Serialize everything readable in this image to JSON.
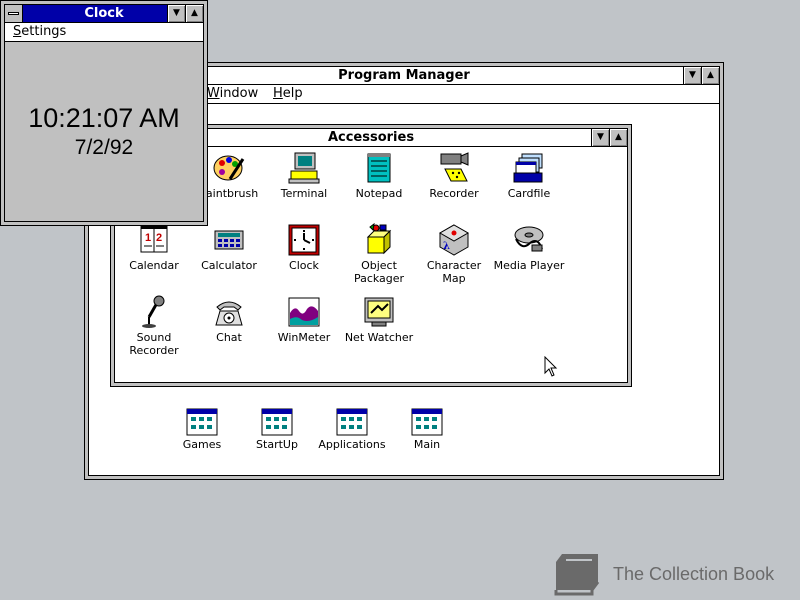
{
  "clock_window": {
    "title": "Clock",
    "menu": {
      "settings_underline": "S",
      "settings_rest": "ettings"
    },
    "time": "10:21:07 AM",
    "date": "7/2/92"
  },
  "program_manager": {
    "title": "Program Manager",
    "menu": {
      "window_label": "indow",
      "help_underline": "H",
      "help_rest": "elp"
    },
    "group_icons": [
      {
        "label": "Games",
        "icon": "program-group-icon"
      },
      {
        "label": "StartUp",
        "icon": "program-group-icon"
      },
      {
        "label": "Applications",
        "icon": "program-group-icon"
      },
      {
        "label": "Main",
        "icon": "program-group-icon"
      }
    ]
  },
  "accessories": {
    "title": "Accessories",
    "icons": [
      {
        "label": "Paintbrush",
        "visible_label": "Paintbrush",
        "icon": "paintbrush-icon"
      },
      {
        "label": "Terminal",
        "icon": "terminal-icon"
      },
      {
        "label": "Notepad",
        "icon": "notepad-icon"
      },
      {
        "label": "Recorder",
        "icon": "recorder-icon"
      },
      {
        "label": "Cardfile",
        "icon": "cardfile-icon"
      },
      {
        "label": "Calendar",
        "icon": "calendar-icon"
      },
      {
        "label": "Calculator",
        "icon": "calculator-icon"
      },
      {
        "label": "Clock",
        "icon": "clock-icon"
      },
      {
        "label": "Object Packager",
        "line1": "Object",
        "line2": "Packager",
        "icon": "object-packager-icon"
      },
      {
        "label": "Character Map",
        "icon": "character-map-icon"
      },
      {
        "label": "Media Player",
        "icon": "media-player-icon"
      },
      {
        "label": "Sound Recorder",
        "line1": "Sound",
        "line2": "Recorder",
        "icon": "microphone-icon"
      },
      {
        "label": "Chat",
        "icon": "telephone-icon"
      },
      {
        "label": "WinMeter",
        "icon": "winmeter-icon"
      },
      {
        "label": "Net Watcher",
        "icon": "net-watcher-icon"
      }
    ]
  },
  "watermark": {
    "text": "The Collection Book",
    "icon": "book-icon"
  }
}
